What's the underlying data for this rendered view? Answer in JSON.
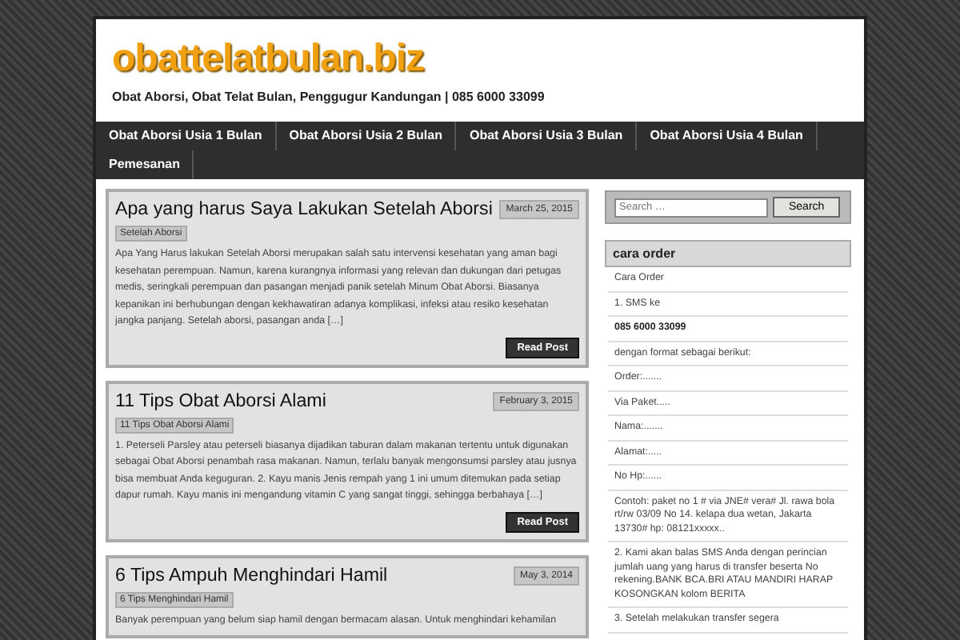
{
  "site": {
    "title": "obattelatbulan.biz",
    "tagline": "Obat Aborsi, Obat Telat Bulan, Penggugur Kandungan | 085 6000 33099"
  },
  "nav": [
    {
      "label": "Obat Aborsi Usia 1 Bulan"
    },
    {
      "label": "Obat Aborsi Usia 2 Bulan"
    },
    {
      "label": "Obat Aborsi Usia 3 Bulan"
    },
    {
      "label": "Obat Aborsi Usia 4 Bulan"
    },
    {
      "label": "Pemesanan"
    }
  ],
  "posts": [
    {
      "title": "Apa yang harus Saya Lakukan Setelah Aborsi",
      "date": "March 25, 2015",
      "tag": "Setelah Aborsi",
      "excerpt": "Apa Yang Harus lakukan Setelah Aborsi merupakan salah satu intervensi kesehatan yang aman bagi kesehatan perempuan. Namun, karena kurangnya informasi yang relevan dan dukungan dari petugas medis, seringkali perempuan dan pasangan menjadi panik setelah Minum Obat Aborsi. Biasanya kepanikan ini berhubungan dengan kekhawatiran adanya komplikasi, infeksi atau resiko kesehatan jangka panjang. Setelah aborsi, pasangan anda […]",
      "button": "Read Post"
    },
    {
      "title": "11 Tips Obat Aborsi Alami",
      "date": "February 3, 2015",
      "tag": "11 Tips Obat Aborsi Alami",
      "excerpt": "1. Peterseli Parsley atau peterseli biasanya dijadikan taburan dalam makanan tertentu untuk digunakan sebagai Obat Aborsi penambah rasa makanan. Namun, terlalu banyak mengonsumsi parsley atau jusnya bisa membuat Anda keguguran. 2. Kayu manis Jenis rempah yang 1 ini umum ditemukan pada setiap dapur rumah. Kayu manis ini mengandung vitamin C yang sangat tinggi, sehingga berbahaya […]",
      "button": "Read Post"
    },
    {
      "title": "6 Tips Ampuh Menghindari Hamil",
      "date": "May 3, 2014",
      "tag": "6 Tips Menghindari Hamil",
      "excerpt": "Banyak perempuan yang belum siap hamil dengan bermacam alasan. Untuk menghindari kehamilan"
    }
  ],
  "search": {
    "placeholder": "Search …",
    "button": "Search"
  },
  "widget": {
    "title": "cara order",
    "items": [
      {
        "text": "Cara Order",
        "bold": false
      },
      {
        "text": "1. SMS ke",
        "bold": false
      },
      {
        "text": "085 6000 33099",
        "bold": true
      },
      {
        "text": "dengan format sebagai berikut:",
        "bold": false
      },
      {
        "text": "Order:.......",
        "bold": false
      },
      {
        "text": "Via Paket.....",
        "bold": false
      },
      {
        "text": "Nama:.......",
        "bold": false
      },
      {
        "text": "Alamat:.....",
        "bold": false
      },
      {
        "text": "No Hp:......",
        "bold": false
      },
      {
        "text": "Contoh: paket no 1 # via JNE# vera# Jl. rawa bola rt/rw 03/09 No 14. kelapa dua wetan, Jakarta 13730# hp: 08121xxxxx..",
        "bold": false
      },
      {
        "text": "2. Kami akan balas SMS Anda dengan perincian jumlah uang yang harus di transfer beserta No rekening.BANK BCA.BRI ATAU MANDIRI HARAP KOSONGKAN kolom BERITA",
        "bold": false
      },
      {
        "text": "3. Setelah melakukan transfer segera",
        "bold": false
      }
    ]
  }
}
